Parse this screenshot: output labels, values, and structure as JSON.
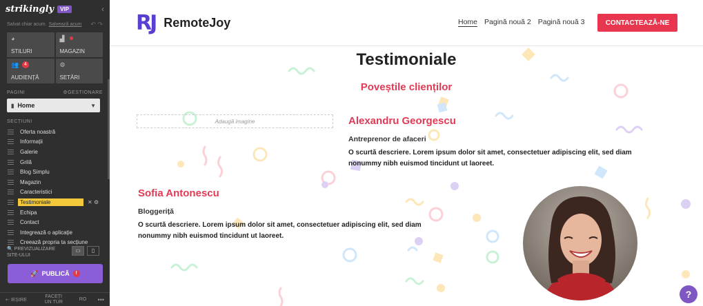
{
  "editor": {
    "logo": "strikingly",
    "vip_badge": "VIP",
    "saved_text": "Salvat chiar acum.",
    "saved_link": "Salvează acum",
    "tiles": [
      {
        "label": "STILURI",
        "icon": "palette-icon"
      },
      {
        "label": "MAGAZIN",
        "icon": "bag-icon"
      },
      {
        "label": "AUDIENȚĂ",
        "icon": "users-icon",
        "badge": "4"
      },
      {
        "label": "SETĂRI",
        "icon": "gear-icon"
      }
    ],
    "pages_label": "PAGINI",
    "manage_label": "GESTIONARE",
    "current_page": "Home",
    "sections_label": "SECȚIUNI",
    "sections": [
      {
        "label": "Oferta noastră"
      },
      {
        "label": "Informații"
      },
      {
        "label": "Galerie"
      },
      {
        "label": "Grilă"
      },
      {
        "label": "Blog Simplu"
      },
      {
        "label": "Magazin"
      },
      {
        "label": "Caracteristici"
      },
      {
        "label": "Testimoniale",
        "active": true
      },
      {
        "label": "Echipa"
      },
      {
        "label": "Contact"
      },
      {
        "label": "Integrează o aplicație"
      },
      {
        "label": "Creează propria ta secțiune"
      }
    ],
    "preview_label": "PREVIZUALIZARE SITE-ULUI",
    "publish_label": "PUBLICĂ",
    "publish_badge": "!",
    "exit_label": "IEȘIRE",
    "tour_label": "FACEȚI UN TUR",
    "lang_label": "RO",
    "more_label": "•••"
  },
  "site": {
    "brand_mark": "RJ",
    "brand_name": "RemoteJoy",
    "nav": [
      {
        "label": "Home",
        "current": true
      },
      {
        "label": "Pagină nouă 2"
      },
      {
        "label": "Pagină nouă 3"
      }
    ],
    "cta_label": "CONTACTEAZĂ-NE",
    "title": "Testimoniale",
    "subtitle": "Poveștile clienților",
    "add_image_label": "Adaugă imagine",
    "testimonials": [
      {
        "name": "Alexandru Georgescu",
        "role": "Antreprenor de afaceri",
        "description": "O scurtă descriere. Lorem ipsum dolor sit amet, consectetuer adipiscing elit, sed diam nonummy nibh euismod tincidunt ut laoreet."
      },
      {
        "name": "Sofia Antonescu",
        "role": "Bloggeriță",
        "description": "O scurtă descriere. Lorem ipsum dolor sit amet, consectetuer adipiscing elit, sed diam nonummy nibh euismod tincidunt ut laoreet."
      }
    ],
    "help_label": "?"
  },
  "colors": {
    "accent": "#e23a55",
    "brand": "#5b3fd0",
    "publish": "#8b5ed8",
    "active_section": "#f3c93b"
  }
}
